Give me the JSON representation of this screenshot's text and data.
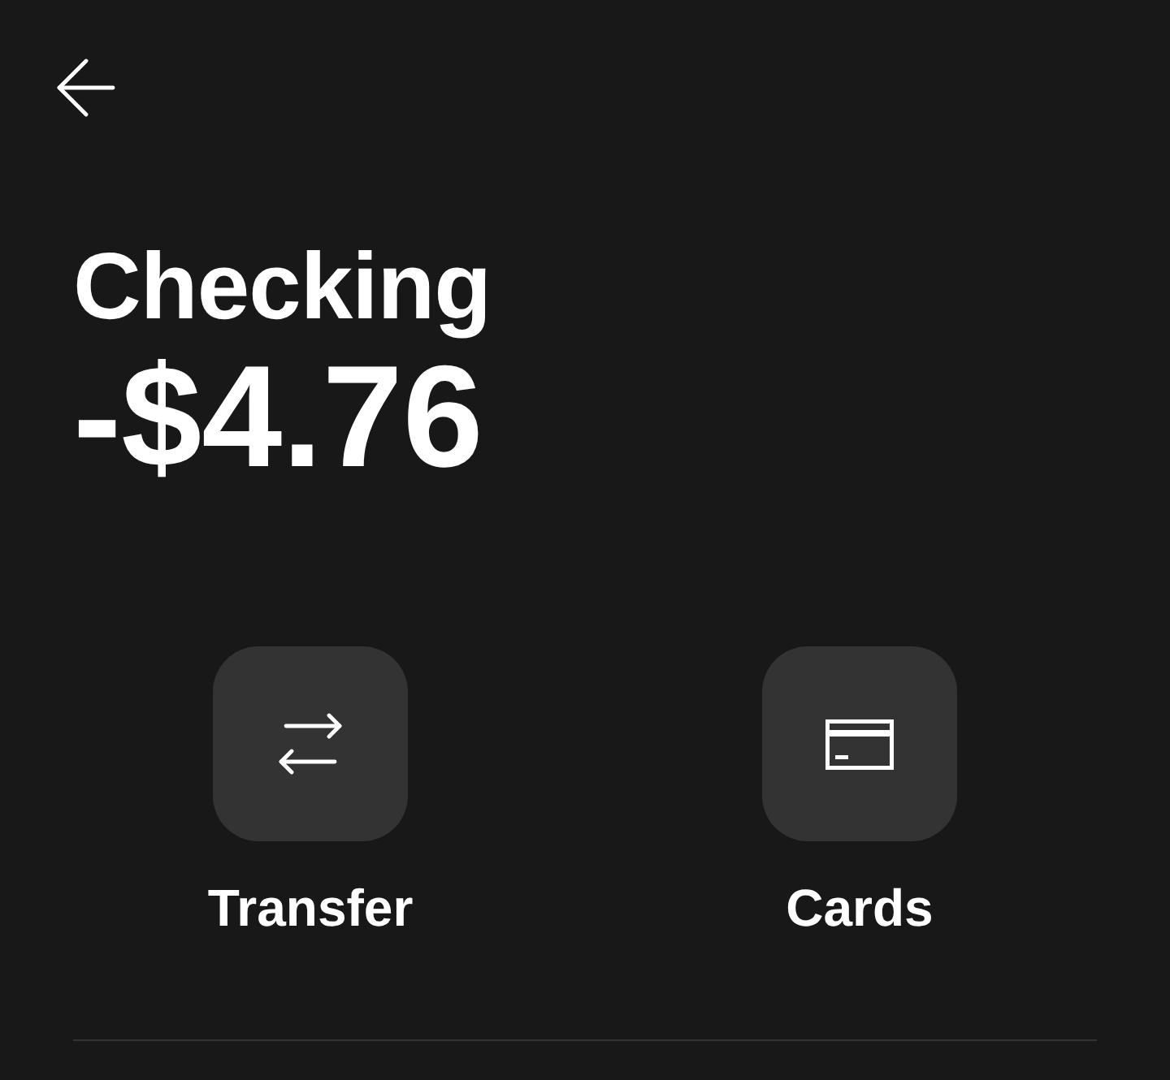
{
  "account": {
    "name": "Checking",
    "balance": "-$4.76"
  },
  "actions": [
    {
      "kind": "transfer",
      "label": "Transfer"
    },
    {
      "kind": "cards",
      "label": "Cards"
    }
  ]
}
